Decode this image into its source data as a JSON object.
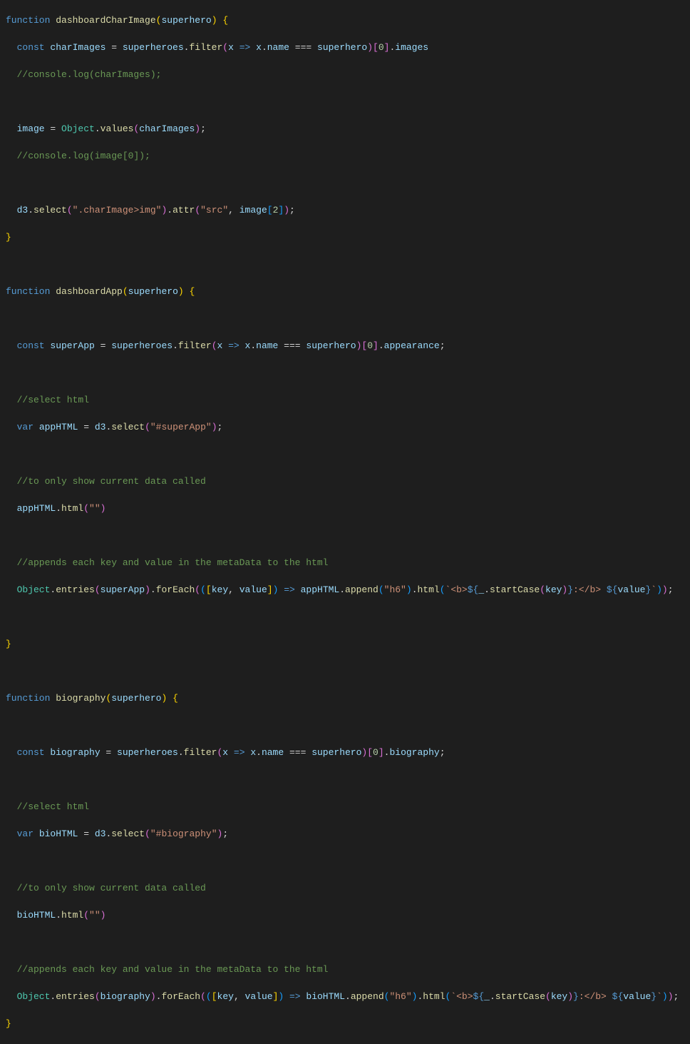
{
  "code": {
    "l1_fn": "function ",
    "l1_name": "dashboardCharImage",
    "l1_p1": "superhero",
    "l2_const": "const ",
    "l2_var": "charImages",
    "l2_eq": " = ",
    "l2_obj": "superheroes",
    "l2_dot1": ".",
    "l2_filter": "filter",
    "l2_x": "x",
    "l2_arrow": " => ",
    "l2_name": "name",
    "l2_eqeq": " === ",
    "l2_sh": "superhero",
    "l2_idx": "0",
    "l2_images": "images",
    "l3_comment": "//console.log(charImages);",
    "l5_image": "image",
    "l5_eq": " = ",
    "l5_Object": "Object",
    "l5_values": "values",
    "l5_charImages": "charImages",
    "l6_comment": "//console.log(image[0]);",
    "l8_d3": "d3",
    "l8_select": "select",
    "l8_sel_str": "\".charImage>img\"",
    "l8_attr": "attr",
    "l8_src": "\"src\"",
    "l8_image": "image",
    "l8_idx": "2",
    "l11_fn": "function ",
    "l11_name": "dashboardApp",
    "l11_p1": "superhero",
    "l13_const": "const ",
    "l13_var": "superApp",
    "l13_appearance": "appearance",
    "l15_comment": "//select html",
    "l16_var_kw": "var ",
    "l16_appHTML": "appHTML",
    "l16_selstr": "\"#superApp\"",
    "l18_comment": "//to only show current data called",
    "l19_appHTML": "appHTML",
    "l19_html": "html",
    "l19_empty": "\"\"",
    "l21_comment": "//appends each key and value in the metaData to the html",
    "l22_Object": "Object",
    "l22_entries": "entries",
    "l22_superApp": "superApp",
    "l22_forEach": "forEach",
    "l22_key": "key",
    "l22_value": "value",
    "l22_appHTML": "appHTML",
    "l22_append": "append",
    "l22_h6": "\"h6\"",
    "l22_html": "html",
    "l22_tpl_open": "`<b>",
    "l22_lodash": "_",
    "l22_startCase": "startCase",
    "l22_tpl_mid": ":</b> ",
    "l22_tpl_close": "`",
    "l25_fn": "function ",
    "l25_name": "biography",
    "l25_p1": "superhero",
    "l27_const": "const ",
    "l27_var": "biography",
    "l27_bio": "biography",
    "l29_comment": "//select html",
    "l30_var_kw": "var ",
    "l30_bioHTML": "bioHTML",
    "l30_selstr": "\"#biography\"",
    "l32_comment": "//to only show current data called",
    "l33_bioHTML": "bioHTML",
    "l35_comment": "//appends each key and value in the metaData to the html",
    "l36_bioHTML": "bioHTML"
  }
}
